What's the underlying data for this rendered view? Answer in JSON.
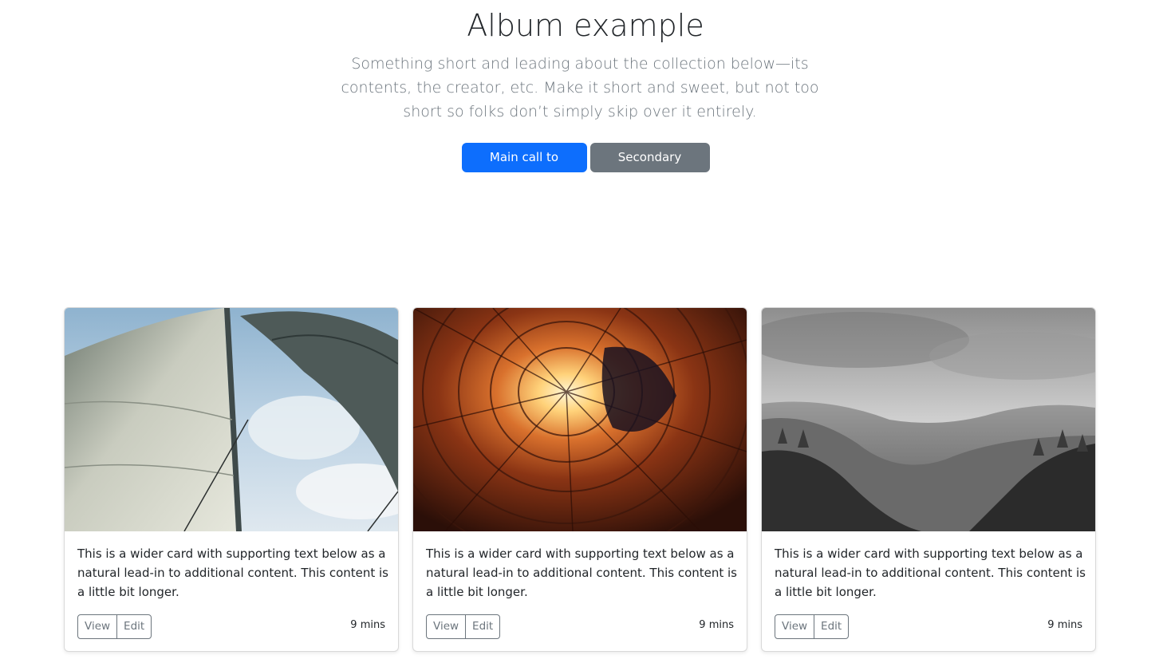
{
  "hero": {
    "title": "Album example",
    "lead": "Something short and leading about the collection below—its contents, the creator, etc. Make it short and sweet, but not too short so folks don’t simply skip over it entirely.",
    "primary_action": "Main call to action",
    "secondary_action": "Secondary action"
  },
  "cards": [
    {
      "image": "sail-photo",
      "text": "This is a wider card with supporting text below as a natural lead-in to additional content. This content is a little bit longer.",
      "view_label": "View",
      "edit_label": "Edit",
      "time": "9 mins"
    },
    {
      "image": "building-courtyard-photo",
      "text": "This is a wider card with supporting text below as a natural lead-in to additional content. This content is a little bit longer.",
      "view_label": "View",
      "edit_label": "Edit",
      "time": "9 mins"
    },
    {
      "image": "valley-landscape-photo",
      "text": "This is a wider card with supporting text below as a natural lead-in to additional content. This content is a little bit longer.",
      "view_label": "View",
      "edit_label": "Edit",
      "time": "9 mins"
    }
  ],
  "colors": {
    "primary": "#0d6efd",
    "secondary": "#6c757d"
  }
}
